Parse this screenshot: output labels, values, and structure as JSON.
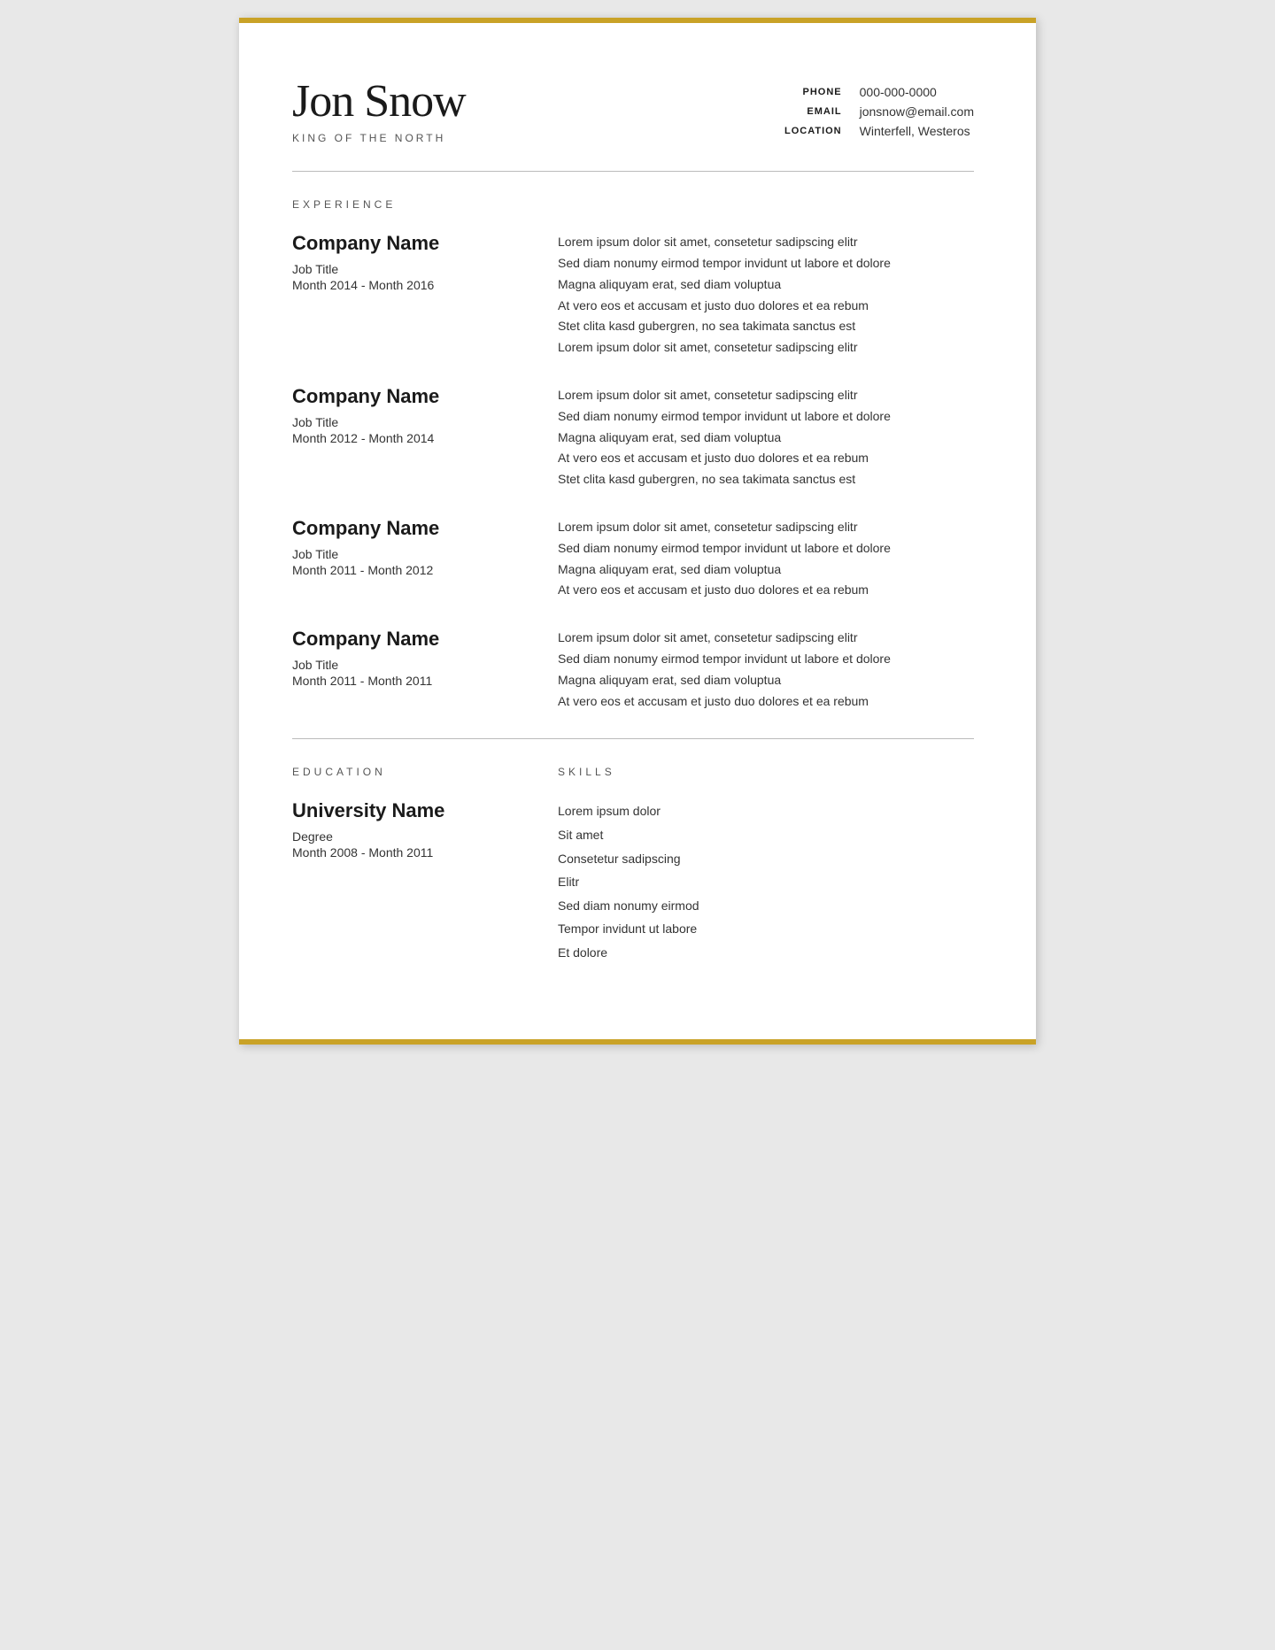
{
  "header": {
    "name": "Jon Snow",
    "subtitle": "KING OF THE NORTH",
    "contact": {
      "phone_label": "PHONE",
      "phone_value": "000-000-0000",
      "email_label": "EMAIL",
      "email_value": "jonsnow@email.com",
      "location_label": "LOCATION",
      "location_value": "Winterfell, Westeros"
    }
  },
  "experience": {
    "section_label": "EXPERIENCE",
    "items": [
      {
        "company": "Company Name",
        "title": "Job Title",
        "dates": "Month 2014 - Month 2016",
        "description": "Lorem ipsum dolor sit amet, consetetur sadipscing elitr\nSed diam nonumy eirmod tempor invidunt ut labore et dolore\nMagna aliquyam erat, sed diam voluptua\nAt vero eos et accusam et justo duo dolores et ea rebum\nStet clita kasd gubergren, no sea takimata sanctus est\nLorem ipsum dolor sit amet, consetetur sadipscing elitr"
      },
      {
        "company": "Company Name",
        "title": "Job Title",
        "dates": "Month 2012 - Month 2014",
        "description": "Lorem ipsum dolor sit amet, consetetur sadipscing elitr\nSed diam nonumy eirmod tempor invidunt ut labore et dolore\nMagna aliquyam erat, sed diam voluptua\nAt vero eos et accusam et justo duo dolores et ea rebum\nStet clita kasd gubergren, no sea takimata sanctus est"
      },
      {
        "company": "Company Name",
        "title": "Job Title",
        "dates": "Month 2011 - Month 2012",
        "description": "Lorem ipsum dolor sit amet, consetetur sadipscing elitr\nSed diam nonumy eirmod tempor invidunt ut labore et dolore\nMagna aliquyam erat, sed diam voluptua\nAt vero eos et accusam et justo duo dolores et ea rebum"
      },
      {
        "company": "Company Name",
        "title": "Job Title",
        "dates": "Month 2011 - Month 2011",
        "description": "Lorem ipsum dolor sit amet, consetetur sadipscing elitr\nSed diam nonumy eirmod tempor invidunt ut labore et dolore\nMagna aliquyam erat, sed diam voluptua\nAt vero eos et accusam et justo duo dolores et ea rebum"
      }
    ]
  },
  "education": {
    "section_label": "EDUCATION",
    "university": "University Name",
    "degree": "Degree",
    "dates": "Month 2008 - Month 2011"
  },
  "skills": {
    "section_label": "SKILLS",
    "items": [
      "Lorem ipsum dolor",
      "Sit amet",
      "Consetetur sadipscing",
      "Elitr",
      "Sed diam nonumy eirmod",
      "Tempor invidunt ut labore",
      "Et dolore"
    ]
  },
  "colors": {
    "accent": "#c9a227",
    "text_dark": "#1a1a1a",
    "text_muted": "#555",
    "divider": "#bbb"
  }
}
